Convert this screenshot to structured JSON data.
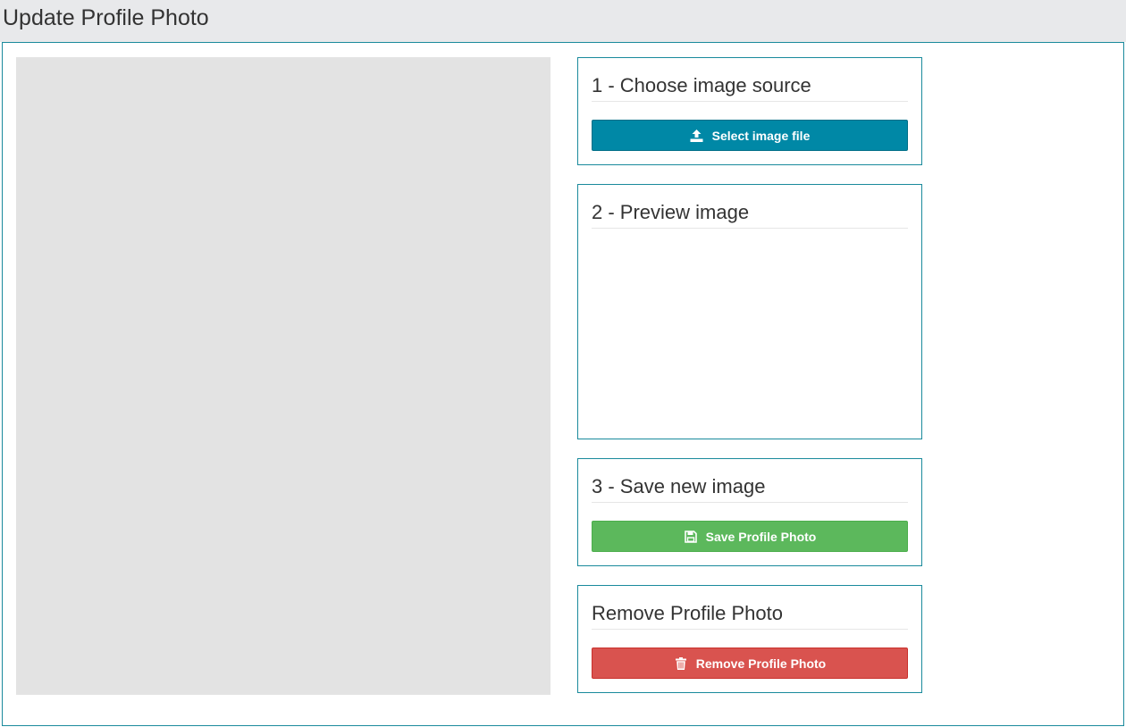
{
  "header": {
    "title": "Update Profile Photo"
  },
  "steps": {
    "choose": {
      "heading": "1 - Choose image source",
      "button_label": "Select image file",
      "button_icon": "upload-icon"
    },
    "preview": {
      "heading": "2 - Preview image"
    },
    "save": {
      "heading": "3 - Save new image",
      "button_label": "Save Profile Photo",
      "button_icon": "floppy-disk-icon"
    },
    "remove": {
      "heading": "Remove Profile Photo",
      "button_label": "Remove Profile Photo",
      "button_icon": "trash-icon"
    }
  },
  "colors": {
    "primary": "#0088a6",
    "success": "#5cb85c",
    "danger": "#d9534f",
    "panel_border": "#1a8a9c",
    "header_bg": "#e8e9eb",
    "crop_bg": "#e3e3e3"
  }
}
